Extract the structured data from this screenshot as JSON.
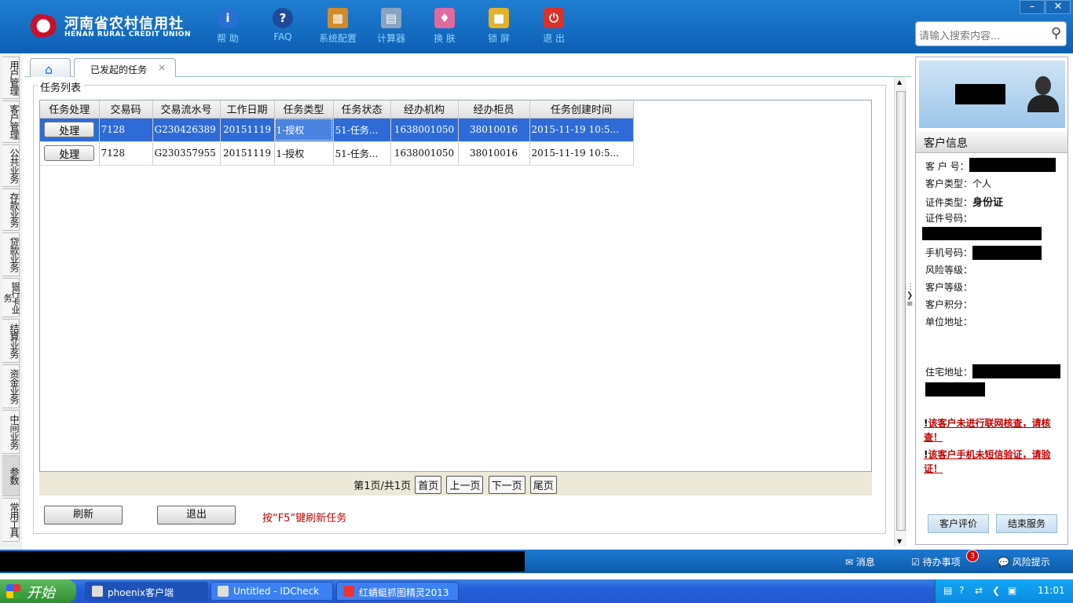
{
  "header": {
    "logo_cn": "河南省农村信用社",
    "logo_en": "HENAN RURAL CREDIT UNION",
    "tools": [
      {
        "label": "帮 助",
        "icon": "info-icon"
      },
      {
        "label": "FAQ",
        "icon": "faq-icon"
      },
      {
        "label": "系统配置",
        "icon": "toolbox-icon"
      },
      {
        "label": "计算器",
        "icon": "calculator-icon"
      },
      {
        "label": "换 肤",
        "icon": "shirt-icon"
      },
      {
        "label": "锁 屏",
        "icon": "lock-icon"
      },
      {
        "label": "退 出",
        "icon": "power-icon"
      }
    ],
    "search_placeholder": "请输入搜索内容..."
  },
  "leftnav": [
    "用户管理",
    "客户管理",
    "公共业务",
    "存款业务",
    "贷款业务",
    "银行卡业务",
    "结算业务",
    "资金业务",
    "中间业务",
    "参数",
    "常用工具"
  ],
  "tabs": {
    "active": "已发起的任务",
    "close": "×"
  },
  "panel_title": "任务列表",
  "table": {
    "columns": [
      "任务处理",
      "交易码",
      "交易流水号",
      "工作日期",
      "任务类型",
      "任务状态",
      "经办机构",
      "经办柜员",
      "任务创建时间"
    ],
    "rows": [
      {
        "action": "处理",
        "code": "7128",
        "serial": "G230426389",
        "date": "20151119",
        "type": "1-授权",
        "status": "51-任务...",
        "org": "1638001050",
        "teller": "38010016",
        "created": "2015-11-19 10:5..."
      },
      {
        "action": "处理",
        "code": "7128",
        "serial": "G230357955",
        "date": "20151119",
        "type": "1-授权",
        "status": "51-任务...",
        "org": "1638001050",
        "teller": "38010016",
        "created": "2015-11-19 10:5..."
      }
    ]
  },
  "pager": {
    "info": "第1页/共1页",
    "first": "首页",
    "prev": "上一页",
    "next": "下一页",
    "last": "尾页"
  },
  "buttons": {
    "refresh": "刷新",
    "exit": "退出"
  },
  "hint": "按“F5”键刷新任务",
  "customer": {
    "heading": "客户信息",
    "labels": {
      "id": "客 户 号：",
      "type": "客户类型：",
      "cert_type": "证件类型：",
      "cert_no": "证件号码：",
      "phone": "手机号码：",
      "risk": "风险等级：",
      "level": "客户等级：",
      "points": "客户积分：",
      "work_addr": "单位地址：",
      "home_addr": "住宅地址："
    },
    "values": {
      "type": "个人",
      "cert_type": "身份证"
    },
    "warnings": [
      "该客户未进行联网核查，请核查！",
      "该客户手机未短信验证，请验证！"
    ],
    "warn_mark": "!",
    "buttons": {
      "evaluate": "客户评价",
      "end": "结束服务"
    }
  },
  "statusbar": {
    "messages": "消息",
    "todo": "待办事项",
    "todo_count": "3",
    "risk": "风险提示"
  },
  "taskbar": {
    "start": "开始",
    "items": [
      "phoenix客户端",
      "Untitled - IDCheck",
      "红蜻蜓抓图精灵2013"
    ],
    "clock": "11:01"
  }
}
